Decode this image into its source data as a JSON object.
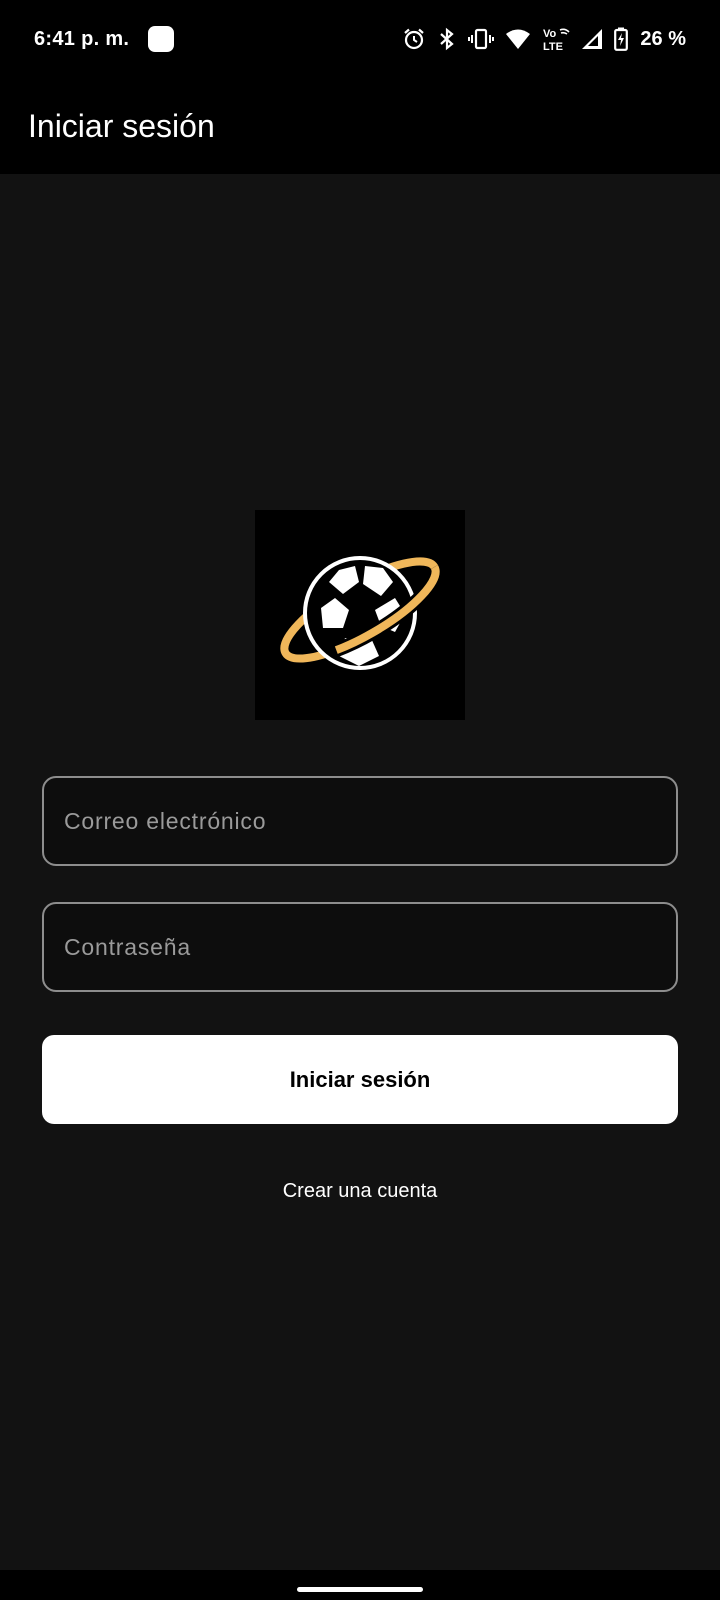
{
  "status_bar": {
    "time": "6:41 p. m.",
    "icons": [
      "notification-app-icon",
      "alarm-icon",
      "bluetooth-icon",
      "vibrate-icon",
      "wifi-icon",
      "volte-icon",
      "cell-signal-icon",
      "battery-charging-icon"
    ],
    "volte_top": "Vo",
    "volte_bottom": "LTE",
    "battery_percent": "26 %"
  },
  "app_bar": {
    "title": "Iniciar sesión"
  },
  "logo": {
    "icon": "soccer-ball-planet-logo",
    "ring_color": "#F0B75A"
  },
  "form": {
    "email_placeholder": "Correo electrónico",
    "email_value": "",
    "password_placeholder": "Contraseña",
    "password_value": "",
    "login_label": "Iniciar sesión",
    "create_account_label": "Crear una cuenta"
  },
  "colors": {
    "background": "#121212",
    "bar": "#000000",
    "button": "#FFFFFF",
    "field_border": "#8D8D8D"
  }
}
